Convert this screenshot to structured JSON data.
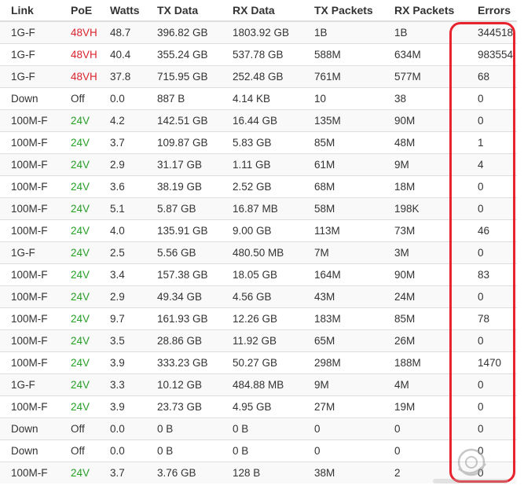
{
  "table": {
    "headers": [
      "Link",
      "PoE",
      "Watts",
      "TX Data",
      "RX Data",
      "TX Packets",
      "RX Packets",
      "Errors"
    ],
    "rows": [
      {
        "link": "1G-F",
        "poe": "48VH",
        "poe_color": "#d9232d",
        "watts": "48.7",
        "tx_data": "396.82 GB",
        "rx_data": "1803.92 GB",
        "tx_packets": "1B",
        "rx_packets": "1B",
        "errors": "344518"
      },
      {
        "link": "1G-F",
        "poe": "48VH",
        "poe_color": "#d9232d",
        "watts": "40.4",
        "tx_data": "355.24 GB",
        "rx_data": "537.78 GB",
        "tx_packets": "588M",
        "rx_packets": "634M",
        "errors": "983554"
      },
      {
        "link": "1G-F",
        "poe": "48VH",
        "poe_color": "#d9232d",
        "watts": "37.8",
        "tx_data": "715.95 GB",
        "rx_data": "252.48 GB",
        "tx_packets": "761M",
        "rx_packets": "577M",
        "errors": "68"
      },
      {
        "link": "Down",
        "poe": "Off",
        "poe_color": "#333333",
        "watts": "0.0",
        "tx_data": "887 B",
        "rx_data": "4.14 KB",
        "tx_packets": "10",
        "rx_packets": "38",
        "errors": "0"
      },
      {
        "link": "100M-F",
        "poe": "24V",
        "poe_color": "#28a028",
        "watts": "4.2",
        "tx_data": "142.51 GB",
        "rx_data": "16.44 GB",
        "tx_packets": "135M",
        "rx_packets": "90M",
        "errors": "0"
      },
      {
        "link": "100M-F",
        "poe": "24V",
        "poe_color": "#28a028",
        "watts": "3.7",
        "tx_data": "109.87 GB",
        "rx_data": "5.83 GB",
        "tx_packets": "85M",
        "rx_packets": "48M",
        "errors": "1"
      },
      {
        "link": "100M-F",
        "poe": "24V",
        "poe_color": "#28a028",
        "watts": "2.9",
        "tx_data": "31.17 GB",
        "rx_data": "1.11 GB",
        "tx_packets": "61M",
        "rx_packets": "9M",
        "errors": "4"
      },
      {
        "link": "100M-F",
        "poe": "24V",
        "poe_color": "#28a028",
        "watts": "3.6",
        "tx_data": "38.19 GB",
        "rx_data": "2.52 GB",
        "tx_packets": "68M",
        "rx_packets": "18M",
        "errors": "0"
      },
      {
        "link": "100M-F",
        "poe": "24V",
        "poe_color": "#28a028",
        "watts": "5.1",
        "tx_data": "5.87 GB",
        "rx_data": "16.87 MB",
        "tx_packets": "58M",
        "rx_packets": "198K",
        "errors": "0"
      },
      {
        "link": "100M-F",
        "poe": "24V",
        "poe_color": "#28a028",
        "watts": "4.0",
        "tx_data": "135.91 GB",
        "rx_data": "9.00 GB",
        "tx_packets": "113M",
        "rx_packets": "73M",
        "errors": "46"
      },
      {
        "link": "1G-F",
        "poe": "24V",
        "poe_color": "#28a028",
        "watts": "2.5",
        "tx_data": "5.56 GB",
        "rx_data": "480.50 MB",
        "tx_packets": "7M",
        "rx_packets": "3M",
        "errors": "0"
      },
      {
        "link": "100M-F",
        "poe": "24V",
        "poe_color": "#28a028",
        "watts": "3.4",
        "tx_data": "157.38 GB",
        "rx_data": "18.05 GB",
        "tx_packets": "164M",
        "rx_packets": "90M",
        "errors": "83"
      },
      {
        "link": "100M-F",
        "poe": "24V",
        "poe_color": "#28a028",
        "watts": "2.9",
        "tx_data": "49.34 GB",
        "rx_data": "4.56 GB",
        "tx_packets": "43M",
        "rx_packets": "24M",
        "errors": "0"
      },
      {
        "link": "100M-F",
        "poe": "24V",
        "poe_color": "#28a028",
        "watts": "9.7",
        "tx_data": "161.93 GB",
        "rx_data": "12.26 GB",
        "tx_packets": "183M",
        "rx_packets": "85M",
        "errors": "78"
      },
      {
        "link": "100M-F",
        "poe": "24V",
        "poe_color": "#28a028",
        "watts": "3.5",
        "tx_data": "28.86 GB",
        "rx_data": "11.92 GB",
        "tx_packets": "65M",
        "rx_packets": "26M",
        "errors": "0"
      },
      {
        "link": "100M-F",
        "poe": "24V",
        "poe_color": "#28a028",
        "watts": "3.9",
        "tx_data": "333.23 GB",
        "rx_data": "50.27 GB",
        "tx_packets": "298M",
        "rx_packets": "188M",
        "errors": "1470"
      },
      {
        "link": "1G-F",
        "poe": "24V",
        "poe_color": "#28a028",
        "watts": "3.3",
        "tx_data": "10.12 GB",
        "rx_data": "484.88 MB",
        "tx_packets": "9M",
        "rx_packets": "4M",
        "errors": "0"
      },
      {
        "link": "100M-F",
        "poe": "24V",
        "poe_color": "#28a028",
        "watts": "3.9",
        "tx_data": "23.73 GB",
        "rx_data": "4.95 GB",
        "tx_packets": "27M",
        "rx_packets": "19M",
        "errors": "0"
      },
      {
        "link": "Down",
        "poe": "Off",
        "poe_color": "#333333",
        "watts": "0.0",
        "tx_data": "0 B",
        "rx_data": "0 B",
        "tx_packets": "0",
        "rx_packets": "0",
        "errors": "0"
      },
      {
        "link": "Down",
        "poe": "Off",
        "poe_color": "#333333",
        "watts": "0.0",
        "tx_data": "0 B",
        "rx_data": "0 B",
        "tx_packets": "0",
        "rx_packets": "0",
        "errors": "0"
      },
      {
        "link": "100M-F",
        "poe": "24V",
        "poe_color": "#28a028",
        "watts": "3.7",
        "tx_data": "3.76 GB",
        "rx_data": "128 B",
        "tx_packets": "38M",
        "rx_packets": "2",
        "errors": "0"
      }
    ]
  },
  "annotation": {
    "highlight_color": "#e8232d"
  }
}
